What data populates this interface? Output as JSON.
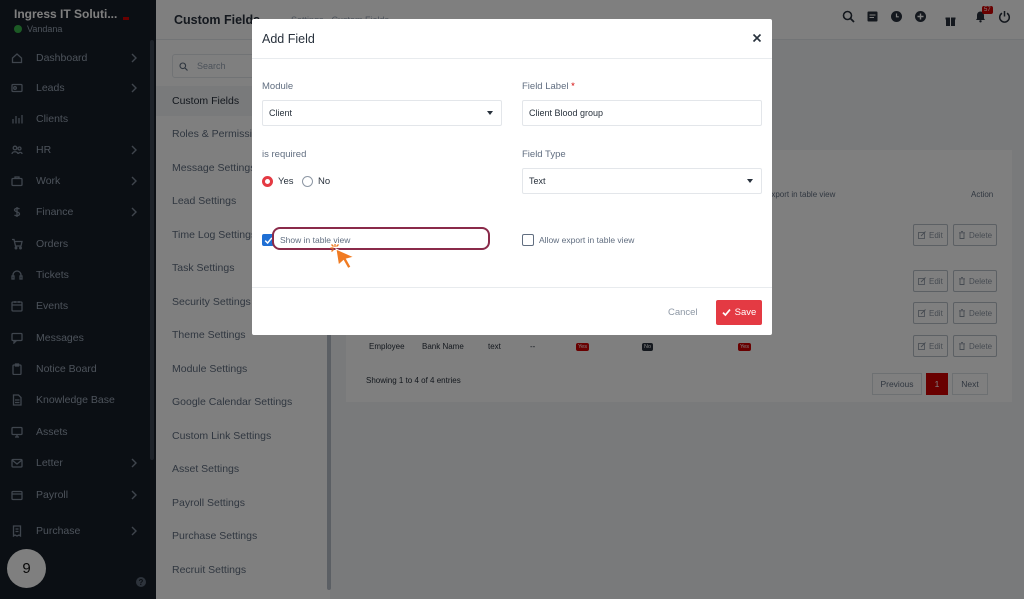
{
  "sidebar": {
    "company": "Ingress IT Soluti...",
    "user": "Vandana",
    "items": [
      {
        "label": "Dashboard",
        "icon": "house-icon",
        "chevron": true
      },
      {
        "label": "Leads",
        "icon": "id-card-icon",
        "chevron": true
      },
      {
        "label": "Clients",
        "icon": "bar-chart-icon",
        "chevron": false
      },
      {
        "label": "HR",
        "icon": "people-icon",
        "chevron": true
      },
      {
        "label": "Work",
        "icon": "briefcase-icon",
        "chevron": true
      },
      {
        "label": "Finance",
        "icon": "dollar-icon",
        "chevron": true
      },
      {
        "label": "Orders",
        "icon": "cart-icon",
        "chevron": false
      },
      {
        "label": "Tickets",
        "icon": "headset-icon",
        "chevron": false
      },
      {
        "label": "Events",
        "icon": "calendar-icon",
        "chevron": false
      },
      {
        "label": "Messages",
        "icon": "chat-icon",
        "chevron": false
      },
      {
        "label": "Notice Board",
        "icon": "clipboard-icon",
        "chevron": false
      },
      {
        "label": "Knowledge Base",
        "icon": "document-icon",
        "chevron": false
      },
      {
        "label": "Assets",
        "icon": "monitor-icon",
        "chevron": false
      },
      {
        "label": "Letter",
        "icon": "envelope-icon",
        "chevron": true
      },
      {
        "label": "Payroll",
        "icon": "wallet-icon",
        "chevron": true
      },
      {
        "label": "Purchase",
        "icon": "receipt-icon",
        "chevron": true
      }
    ],
    "step_number": "9",
    "help_icon": "?"
  },
  "header": {
    "page_title": "Custom Fields",
    "breadcrumb": "Settings · Custom Fields",
    "notification_count": "57",
    "icons": [
      "search-icon",
      "sticky-note-icon",
      "clock-icon",
      "plus-circle-icon",
      "gift-icon",
      "bell-icon",
      "power-icon"
    ]
  },
  "settings_menu": {
    "search_placeholder": "Search",
    "items": [
      "Custom Fields",
      "Roles & Permissions",
      "Message Settings",
      "Lead Settings",
      "Time Log Settings",
      "Task Settings",
      "Security Settings",
      "Theme Settings",
      "Module Settings",
      "Google Calendar Settings",
      "Custom Link Settings",
      "Asset Settings",
      "Payroll Settings",
      "Purchase Settings",
      "Recruit Settings"
    ],
    "active_index": 0
  },
  "table": {
    "header_export": "Export in table view",
    "header_action": "Action",
    "edit_label": "Edit",
    "delete_label": "Delete",
    "last_row": {
      "module": "Employee",
      "label": "Bank Name",
      "type": "text",
      "required": "--",
      "show": "Yes",
      "no": "No",
      "export": "Yes"
    },
    "showing": "Showing 1 to 4 of 4 entries",
    "prev": "Previous",
    "page": "1",
    "next": "Next"
  },
  "modal": {
    "title": "Add Field",
    "module_label": "Module",
    "module_value": "Client",
    "field_label_label": "Field Label",
    "field_label_required": "*",
    "field_label_value": "Client Blood group",
    "required_label": "is required",
    "yes_label": "Yes",
    "no_label": "No",
    "field_type_label": "Field Type",
    "field_type_value": "Text",
    "show_table_label": "Show in table view",
    "allow_export_label": "Allow export in table view",
    "cancel_label": "Cancel",
    "save_label": "Save"
  }
}
